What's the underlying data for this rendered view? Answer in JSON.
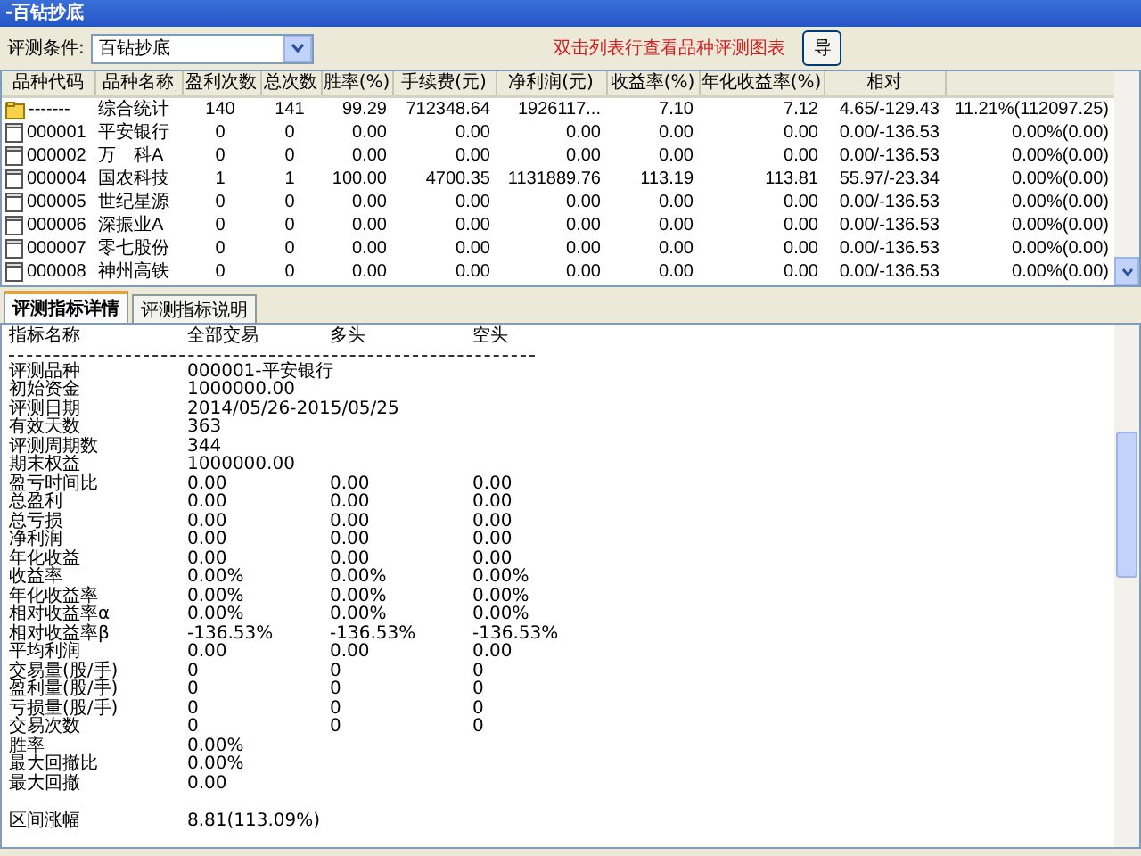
{
  "window": {
    "title": "-百钻抄底"
  },
  "toolbar": {
    "label": "评测条件:",
    "select_value": "百钻抄底",
    "hint": "双击列表行查看品种评测图表",
    "buttons": [
      "导"
    ]
  },
  "table": {
    "columns": [
      "品种代码",
      "品种名称",
      "盈利次数",
      "总次数",
      "胜率(%)",
      "手续费(元)",
      "净利润(元)",
      "收益率(%)",
      "年化收益率(%)",
      "相对"
    ],
    "rows": [
      {
        "kind": "summary",
        "cells": [
          "-------",
          "综合统计",
          "140",
          "141",
          "99.29",
          "712348.64",
          "1926117...",
          "7.10",
          "7.12",
          "4.65/-129.43",
          "11.21%(112097.25)"
        ]
      },
      {
        "kind": "stock",
        "cells": [
          "000001",
          "平安银行",
          "0",
          "0",
          "0.00",
          "0.00",
          "0.00",
          "0.00",
          "0.00",
          "0.00/-136.53",
          "0.00%(0.00)"
        ]
      },
      {
        "kind": "stock",
        "cells": [
          "000002",
          "万　科A",
          "0",
          "0",
          "0.00",
          "0.00",
          "0.00",
          "0.00",
          "0.00",
          "0.00/-136.53",
          "0.00%(0.00)"
        ]
      },
      {
        "kind": "stock",
        "cells": [
          "000004",
          "国农科技",
          "1",
          "1",
          "100.00",
          "4700.35",
          "1131889.76",
          "113.19",
          "113.81",
          "55.97/-23.34",
          "0.00%(0.00)"
        ]
      },
      {
        "kind": "stock",
        "cells": [
          "000005",
          "世纪星源",
          "0",
          "0",
          "0.00",
          "0.00",
          "0.00",
          "0.00",
          "0.00",
          "0.00/-136.53",
          "0.00%(0.00)"
        ]
      },
      {
        "kind": "stock",
        "cells": [
          "000006",
          "深振业A",
          "0",
          "0",
          "0.00",
          "0.00",
          "0.00",
          "0.00",
          "0.00",
          "0.00/-136.53",
          "0.00%(0.00)"
        ]
      },
      {
        "kind": "stock",
        "cells": [
          "000007",
          "零七股份",
          "0",
          "0",
          "0.00",
          "0.00",
          "0.00",
          "0.00",
          "0.00",
          "0.00/-136.53",
          "0.00%(0.00)"
        ]
      },
      {
        "kind": "stock",
        "cells": [
          "000008",
          "神州高铁",
          "0",
          "0",
          "0.00",
          "0.00",
          "0.00",
          "0.00",
          "0.00",
          "0.00/-136.53",
          "0.00%(0.00)"
        ]
      }
    ]
  },
  "tabs": [
    {
      "label": "评测指标详情",
      "selected": true
    },
    {
      "label": "评测指标说明",
      "selected": false
    }
  ],
  "detail": {
    "headers": [
      "指标名称",
      "全部交易",
      "多头",
      "空头"
    ],
    "rows": [
      {
        "label": "评测品种",
        "values": [
          "000001-平安银行"
        ]
      },
      {
        "label": "初始资金",
        "values": [
          "1000000.00"
        ]
      },
      {
        "label": "评测日期",
        "values": [
          "2014/05/26-2015/05/25"
        ]
      },
      {
        "label": "有效天数",
        "values": [
          "363"
        ]
      },
      {
        "label": "评测周期数",
        "values": [
          "344"
        ]
      },
      {
        "label": "期末权益",
        "values": [
          "1000000.00"
        ]
      },
      {
        "label": "盈亏时间比",
        "values": [
          "0.00",
          "0.00",
          "0.00"
        ]
      },
      {
        "label": "总盈利",
        "values": [
          "0.00",
          "0.00",
          "0.00"
        ]
      },
      {
        "label": "总亏损",
        "values": [
          "0.00",
          "0.00",
          "0.00"
        ]
      },
      {
        "label": "净利润",
        "values": [
          "0.00",
          "0.00",
          "0.00"
        ]
      },
      {
        "label": "年化收益",
        "values": [
          "0.00",
          "0.00",
          "0.00"
        ]
      },
      {
        "label": "收益率",
        "values": [
          "0.00%",
          "0.00%",
          "0.00%"
        ]
      },
      {
        "label": "年化收益率",
        "values": [
          "0.00%",
          "0.00%",
          "0.00%"
        ]
      },
      {
        "label": "相对收益率α",
        "values": [
          "0.00%",
          "0.00%",
          "0.00%"
        ]
      },
      {
        "label": "相对收益率β",
        "values": [
          "-136.53%",
          "-136.53%",
          "-136.53%"
        ]
      },
      {
        "label": "平均利润",
        "values": [
          "0.00",
          "0.00",
          "0.00"
        ]
      },
      {
        "label": "交易量(股/手)",
        "values": [
          "0",
          "0",
          "0"
        ]
      },
      {
        "label": "盈利量(股/手)",
        "values": [
          "0",
          "0",
          "0"
        ]
      },
      {
        "label": "亏损量(股/手)",
        "values": [
          "0",
          "0",
          "0"
        ]
      },
      {
        "label": "交易次数",
        "values": [
          "0",
          "0",
          "0"
        ]
      },
      {
        "label": "胜率",
        "values": [
          "0.00%"
        ]
      },
      {
        "label": "最大回撤比",
        "values": [
          "0.00%"
        ]
      },
      {
        "label": "最大回撤",
        "values": [
          "0.00"
        ]
      },
      {
        "label": "区间涨幅",
        "values": [
          "8.81(113.09%)"
        ],
        "gap_before": true
      }
    ]
  }
}
